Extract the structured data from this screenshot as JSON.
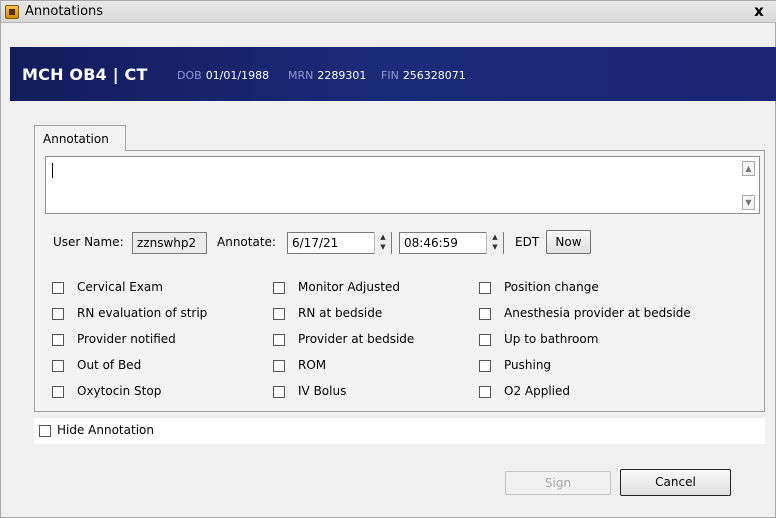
{
  "window": {
    "title": "Annotations",
    "close_label": "x"
  },
  "header": {
    "patient": "MCH OB4 | CT",
    "dob_label": "DOB",
    "dob": "01/01/1988",
    "mrn_label": "MRN",
    "mrn": "2289301",
    "fin_label": "FIN",
    "fin": "256328071",
    "bg_color": "#1b2574"
  },
  "tab": {
    "label": "Annotation"
  },
  "annotation_text": "",
  "form": {
    "user_name_label": "User Name:",
    "user_name": "zznswhp2",
    "annotate_label": "Annotate:",
    "date": "6/17/21",
    "time": "08:46:59",
    "timezone": "EDT",
    "now_label": "Now"
  },
  "checkboxes": {
    "col1": [
      "Cervical Exam",
      "RN evaluation of strip",
      "Provider notified",
      "Out of Bed",
      "Oxytocin Stop"
    ],
    "col2": [
      "Monitor Adjusted",
      "RN at bedside",
      "Provider at bedside",
      "ROM",
      "IV Bolus"
    ],
    "col3": [
      "Position change",
      "Anesthesia provider at bedside",
      "Up to bathroom",
      "Pushing",
      "O2 Applied"
    ]
  },
  "hide_annotation_label": "Hide Annotation",
  "buttons": {
    "sign": "Sign",
    "cancel": "Cancel"
  }
}
